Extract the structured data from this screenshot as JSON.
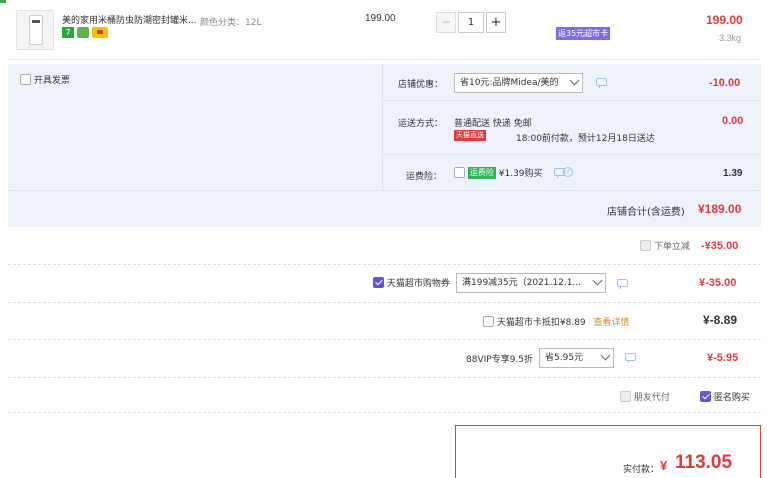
{
  "product": {
    "title": "美的家用米桶防虫防潮密封罐米...",
    "spec": "颜色分类：12L",
    "unit_price": "199.00",
    "quantity": "1",
    "subtotal": "199.00",
    "weight": "3.3kg",
    "promo_tag": "返35元超市卡",
    "badge_number": "7"
  },
  "invoice": {
    "label": "开具发票"
  },
  "shop_discount": {
    "label": "店铺优惠：",
    "selected": "省10元:品牌Midea/美的",
    "amount": "-10.00"
  },
  "delivery": {
    "label": "运送方式：",
    "method": "普通配送 快递 免邮",
    "tmall_tag": "天猫直送",
    "eta": "18:00前付款，预计12月18日送达",
    "amount": "0.00"
  },
  "shipping_insurance": {
    "label": "运费险：",
    "tag": "运费险",
    "text": "¥1.39购买",
    "amount": "1.39"
  },
  "shop_total": {
    "label": "店铺合计(含运费)",
    "amount": "¥189.00"
  },
  "order_discount": {
    "label": "下单立减",
    "amount": "-¥35.00"
  },
  "coupon": {
    "label": "天猫超市购物券",
    "selected": "满199减35元（2021.12.1...",
    "amount": "¥-35.00"
  },
  "card_deduct": {
    "label": "天猫超市卡抵扣¥8.89",
    "link": "查看详情",
    "amount": "¥-8.89"
  },
  "vip": {
    "label": "88VIP专享9.5折",
    "selected": "省5.95元",
    "amount": "¥-5.95"
  },
  "options": {
    "friend_pay": "朋友代付",
    "anonymous": "匿名购买"
  },
  "pay": {
    "label": "实付款：",
    "currency": "¥",
    "amount": "113.05"
  },
  "colors": {
    "accent": "#e4393c",
    "purple": "#6a4fe0",
    "row_bg": "#eef3fb"
  }
}
